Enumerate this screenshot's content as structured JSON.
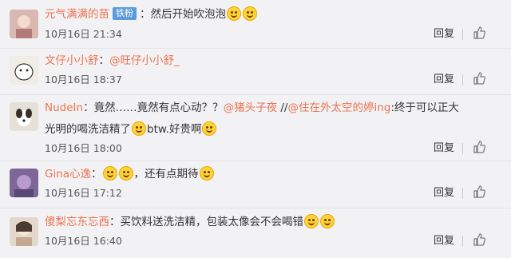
{
  "comments": [
    {
      "user": "元气满满的苗",
      "badge": "铁粉",
      "text": "：然后开始吹泡泡",
      "time": "10月16日 21:34",
      "reply": "回复",
      "avatar_color": "#c9a6a3",
      "emoji_count": 2
    },
    {
      "user": "文仔小小舒",
      "colon": "：",
      "mention": "@旺仔小小舒_",
      "time": "10月16日 18:37",
      "reply": "回复",
      "avatar_color": "#e9e4dc"
    },
    {
      "user": "NudeIn",
      "text_a": "：竟然……竟然有点心动？？",
      "mention1": "@猪头子夜",
      "text_b": " //",
      "mention2": "@住在外太空的婷ing",
      "text_c": ":终于可以正大光明的喝洗洁精了",
      "text_d": "btw.好贵啊",
      "time": "10月16日 18:00",
      "reply": "回复",
      "avatar_color": "#d9d4c8"
    },
    {
      "user": "Gina心逸",
      "text_a": "：",
      "text_b": "，还有点期待",
      "time": "10月16日 17:12",
      "reply": "回复",
      "avatar_color": "#8f74a8"
    },
    {
      "user": "傻梨忘东忘西",
      "text": "：买饮料送洗洁精，包装太像会不会喝错",
      "time": "10月16日 16:40",
      "reply": "回复",
      "avatar_color": "#d8c9b8"
    }
  ],
  "colors": {
    "username": "#eb7350",
    "badge": "#5c9bda",
    "background": "#f2f2f5"
  }
}
